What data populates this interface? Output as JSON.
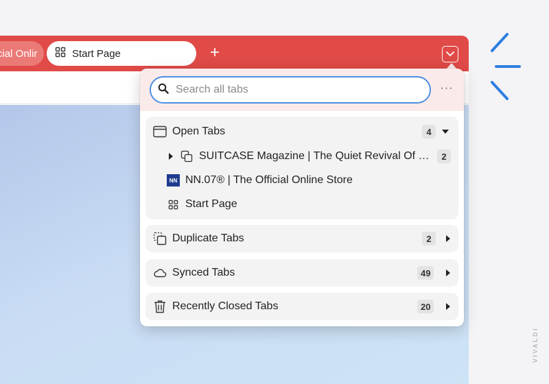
{
  "window": {
    "tabs": [
      {
        "label": "cial Onlir",
        "active": false
      },
      {
        "label": "Start Page",
        "active": true
      }
    ],
    "new_tab_label": "+"
  },
  "colors": {
    "accent": "#e04a47",
    "search_border": "#4a90e2"
  },
  "tab_panel": {
    "search": {
      "placeholder": "Search all tabs",
      "value": ""
    },
    "more_label": "···",
    "open_tabs": {
      "label": "Open Tabs",
      "count": "4",
      "items": [
        {
          "label": "SUITCASE Magazine | The Quiet Revival Of G...",
          "count": "2",
          "icon": "stack-icon"
        },
        {
          "label": "NN.07® | The Official Online Store",
          "icon": "nn-favicon",
          "favicon_text": "NN"
        },
        {
          "label": "Start Page",
          "icon": "grid-icon"
        }
      ]
    },
    "duplicate_tabs": {
      "label": "Duplicate Tabs",
      "count": "2"
    },
    "synced_tabs": {
      "label": "Synced Tabs",
      "count": "49"
    },
    "recently_closed": {
      "label": "Recently Closed Tabs",
      "count": "20"
    }
  },
  "watermark": "VIVALDI"
}
